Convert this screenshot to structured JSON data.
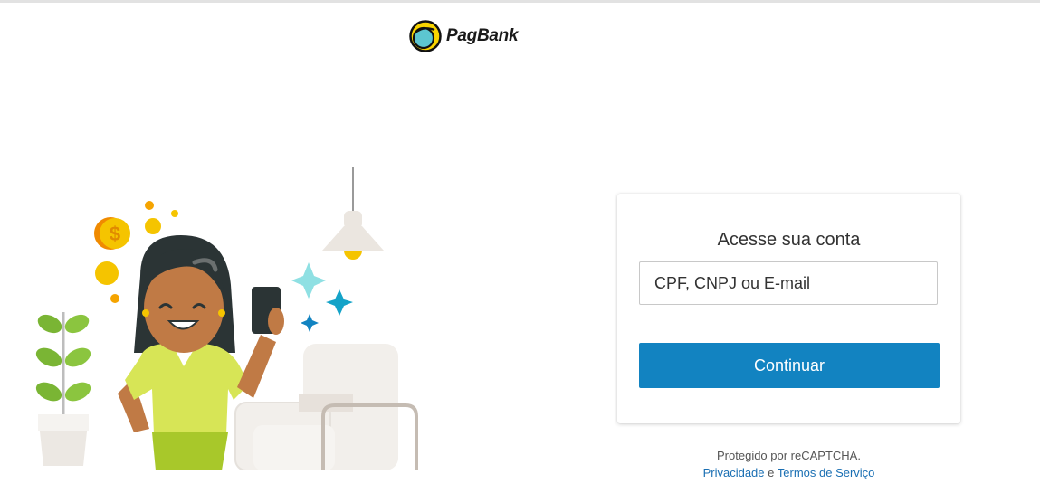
{
  "header": {
    "brand": "PagBank"
  },
  "login": {
    "title": "Acesse sua conta",
    "input_placeholder": "CPF, CNPJ ou E-mail",
    "input_value": "",
    "continue_label": "Continuar"
  },
  "recaptcha": {
    "protected_text": "Protegido por reCAPTCHA.",
    "privacy_label": "Privacidade",
    "conjunction": "e",
    "terms_label": "Termos de Serviço"
  },
  "illustration": {
    "coin_symbol": "$"
  },
  "colors": {
    "primary_button": "#1283c1",
    "link": "#1a6fb3",
    "coin": "#f5c400",
    "shirt": "#d7e556",
    "skirt": "#a8c82a"
  }
}
